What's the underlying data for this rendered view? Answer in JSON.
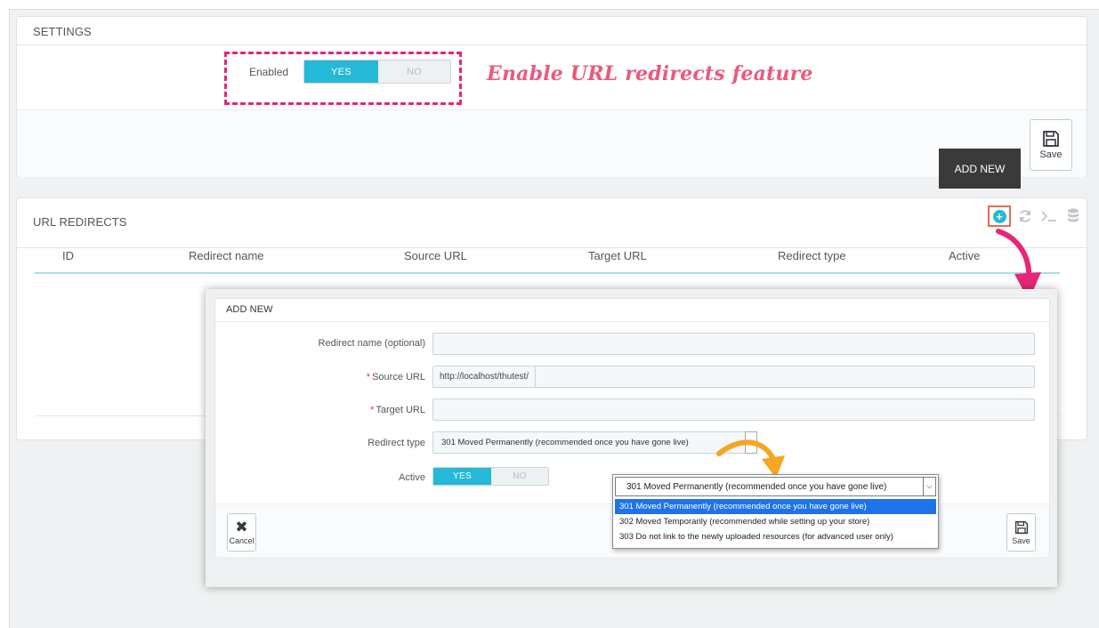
{
  "settings": {
    "title": "SETTINGS",
    "enabled_label": "Enabled",
    "yes": "YES",
    "no": "NO",
    "save_label": "Save",
    "callout": "Enable URL redirects feature"
  },
  "tooltip": "ADD NEW",
  "redirects": {
    "title": "URL REDIRECTS",
    "columns": [
      "ID",
      "Redirect name",
      "Source URL",
      "Target URL",
      "Redirect type",
      "Active"
    ],
    "toolbar_icons": [
      "add-icon",
      "refresh-icon",
      "terminal-icon",
      "database-icon"
    ]
  },
  "modal": {
    "title": "ADD NEW",
    "redirect_name_label": "Redirect name (optional)",
    "source_url_label": "Source URL",
    "source_url_prefix": "http://localhost/thutest/",
    "target_url_label": "Target URL",
    "redirect_type_label": "Redirect type",
    "redirect_type_value": "301 Moved Permanently (recommended once you have gone live)",
    "active_label": "Active",
    "yes": "YES",
    "no": "NO",
    "cancel_label": "Cancel",
    "save_label": "Save"
  },
  "dropdown": {
    "current": "301 Moved Permanently (recommended once you have gone live)",
    "options": [
      "301 Moved Permanently (recommended once you have gone live)",
      "302 Moved Temporarily (recommended while setting up your store)",
      "303 Do not link to the newly uploaded resources (for advanced user only)"
    ],
    "selected_index": 0
  },
  "colors": {
    "accent": "#25b9d7",
    "annotation_pink": "#e62678",
    "annotation_orange": "#f5a623"
  }
}
